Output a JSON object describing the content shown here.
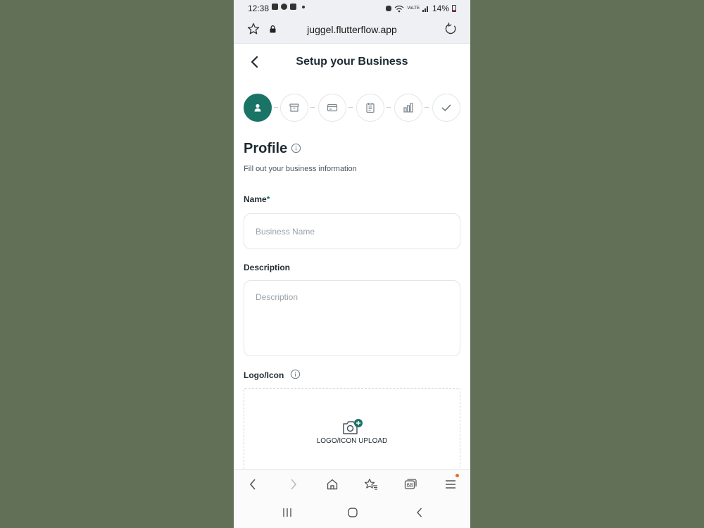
{
  "status_bar": {
    "time": "12:38",
    "network": "VoLTE",
    "battery": "14%"
  },
  "browser": {
    "url": "juggel.flutterflow.app",
    "tab_count": "68"
  },
  "page": {
    "title": "Setup your Business",
    "steps": [
      {
        "icon": "person-icon",
        "active": true
      },
      {
        "icon": "archive-icon",
        "active": false
      },
      {
        "icon": "card-icon",
        "active": false
      },
      {
        "icon": "clipboard-icon",
        "active": false
      },
      {
        "icon": "bar-chart-icon",
        "active": false
      },
      {
        "icon": "check-icon",
        "active": false
      }
    ],
    "section_title": "Profile",
    "section_subtitle": "Fill out your business information",
    "name_label": "Name",
    "required_mark": "*",
    "name_placeholder": "Business Name",
    "description_label": "Description",
    "description_placeholder": "Description",
    "logo_label": "Logo/Icon",
    "upload_label": "LOGO/ICON UPLOAD"
  },
  "colors": {
    "accent": "#1a7466",
    "background": "#617056",
    "text": "#1e2a32"
  }
}
